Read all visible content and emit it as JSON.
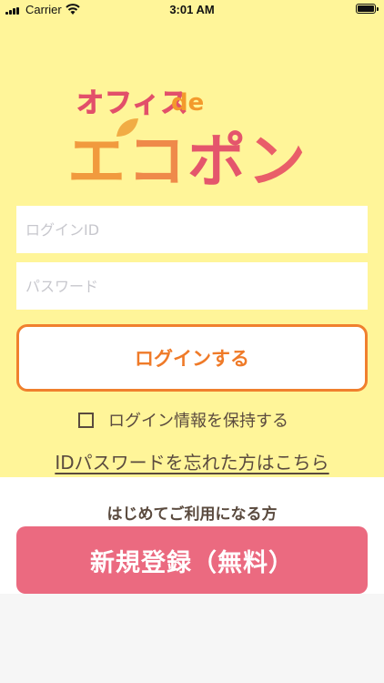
{
  "status_bar": {
    "carrier": "Carrier",
    "time": "3:01 AM"
  },
  "logo": {
    "line1": "オフィス",
    "de": "de",
    "main_chars": [
      "エ",
      "コ",
      "ポ",
      "ン"
    ]
  },
  "form": {
    "login_id_placeholder": "ログインID",
    "password_placeholder": "パスワード",
    "login_button": "ログインする",
    "remember_label": "ログイン情報を保持する",
    "remember_checked": false,
    "forgot_link": "IDパスワードを忘れた方はこちら"
  },
  "register": {
    "prompt": "はじめてご利用になる方",
    "button": "新規登録（無料）"
  },
  "colors": {
    "top_background": "#fff599",
    "login_accent": "#f0802e",
    "register_button": "#eb6a80",
    "text_brown": "#5a4a3e"
  }
}
